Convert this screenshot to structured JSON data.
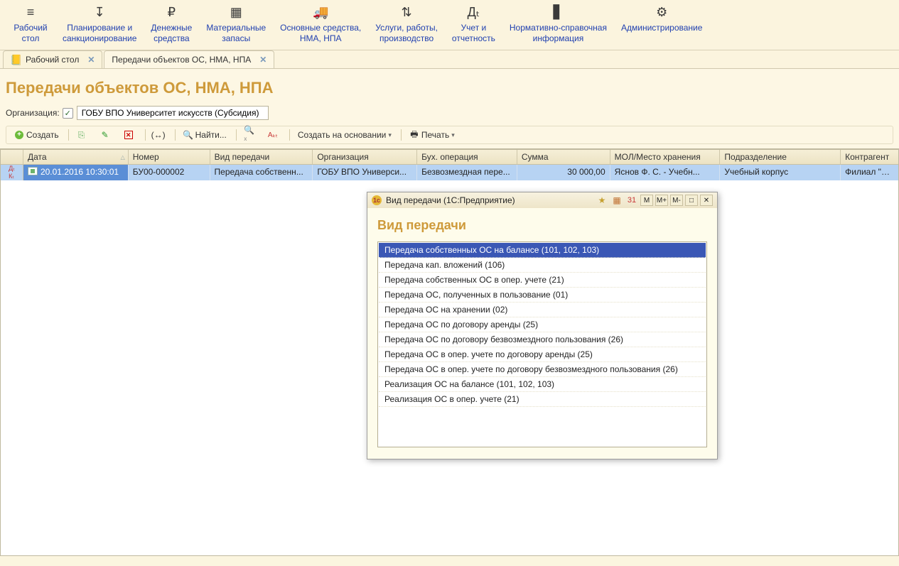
{
  "main_nav": [
    {
      "label": "Рабочий\nстол",
      "icon": "≡"
    },
    {
      "label": "Планирование и\nсанкционирование",
      "icon": "↧"
    },
    {
      "label": "Денежные\nсредства",
      "icon": "₽"
    },
    {
      "label": "Материальные\nзапасы",
      "icon": "▦"
    },
    {
      "label": "Основные средства,\nНМА, НПА",
      "icon": "🚚"
    },
    {
      "label": "Услуги, работы,\nпроизводство",
      "icon": "⇅"
    },
    {
      "label": "Учет и\nотчетность",
      "icon": "Дₜ"
    },
    {
      "label": "Нормативно-справочная\nинформация",
      "icon": "▋"
    },
    {
      "label": "Администрирование",
      "icon": "⚙"
    }
  ],
  "tabs": [
    {
      "label": "Рабочий стол",
      "active": false
    },
    {
      "label": "Передачи объектов ОС, НМА, НПА",
      "active": true
    }
  ],
  "page_title": "Передачи объектов ОС, НМА, НПА",
  "filter": {
    "label": "Организация:",
    "checked": true,
    "value": "ГОБУ ВПО Университет искусств (Субсидия)"
  },
  "toolbar": {
    "create": "Создать",
    "find": "Найти...",
    "create_based": "Создать на основании",
    "print": "Печать"
  },
  "grid": {
    "columns": [
      "",
      "Дата",
      "Номер",
      "Вид передачи",
      "Организация",
      "Бух. операция",
      "Сумма",
      "МОЛ/Место хранения",
      "Подразделение",
      "Контрагент"
    ],
    "row": {
      "date": "20.01.2016 10:30:01",
      "number": "БУ00-000002",
      "type": "Передача собственн...",
      "org": "ГОБУ ВПО Универси...",
      "acct_op": "Безвозмездная пере...",
      "sum": "30 000,00",
      "mol": "Яснов Ф. С. - Учебн...",
      "dept": "Учебный корпус",
      "contr": "Филиал \"Универс..."
    }
  },
  "modal": {
    "title": "Вид передачи  (1С:Предприятие)",
    "heading": "Вид передачи",
    "buttons": [
      "M",
      "M+",
      "M-"
    ],
    "items": [
      "Передача собственных ОС на балансе (101, 102, 103)",
      "Передача кап. вложений (106)",
      "Передача собственных ОС в опер. учете (21)",
      "Передача ОС, полученных в пользование (01)",
      "Передача ОС на хранении (02)",
      "Передача ОС по договору аренды (25)",
      "Передача ОС по договору безвозмездного пользования (26)",
      "Передача ОС в опер. учете по договору аренды (25)",
      "Передача ОС в опер. учете по договору безвозмездного пользования (26)",
      "Реализация ОС на балансе (101, 102, 103)",
      "Реализация ОС в опер. учете (21)"
    ],
    "selected_index": 0
  }
}
